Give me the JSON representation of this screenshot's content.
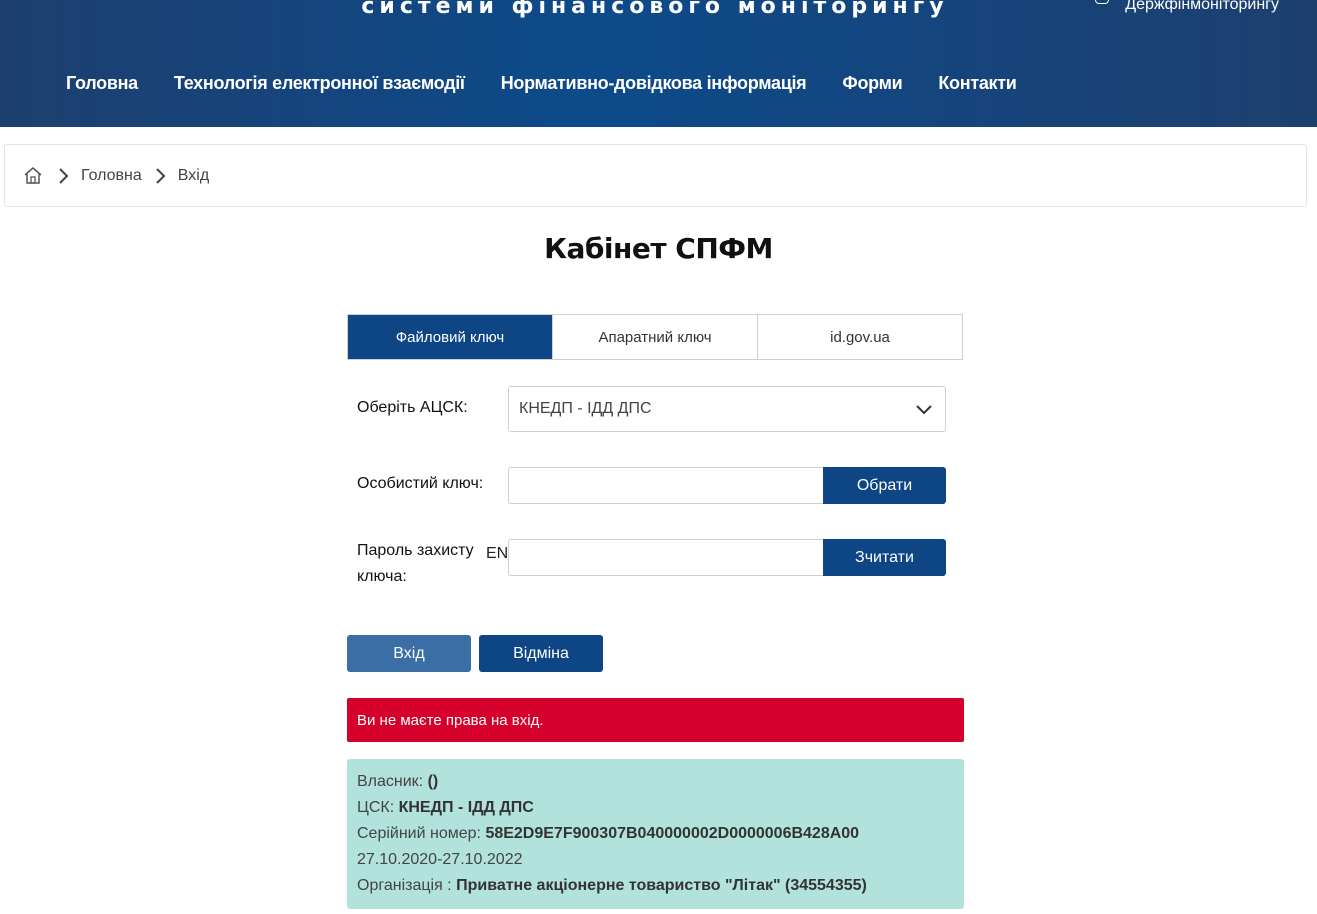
{
  "header": {
    "title": "системи фінансового моніторингу",
    "user_text": "Держфінмоніторингу",
    "nav": [
      "Головна",
      "Технологія електронної взаємодії",
      "Нормативно-довідкова інформація",
      "Форми",
      "Контакти"
    ]
  },
  "breadcrumb": {
    "items": [
      "Головна",
      "Вхід"
    ]
  },
  "page": {
    "title": "Кабінет СПФМ"
  },
  "tabs": [
    {
      "label": "Файловий ключ",
      "active": true
    },
    {
      "label": "Апаратний ключ",
      "active": false
    },
    {
      "label": "id.gov.ua",
      "active": false
    }
  ],
  "form": {
    "acsk_label": "Оберіть АЦСК:",
    "acsk_value": "КНЕДП - ІДД ДПС",
    "key_label": "Особистий ключ:",
    "key_value": "",
    "choose_button": "Обрати",
    "password_label_1": "Пароль захисту",
    "password_label_2": "ключа:",
    "password_lang": "EN",
    "password_value": "",
    "read_button": "Зчитати",
    "login_button": "Вхід",
    "cancel_button": "Відміна"
  },
  "alert": {
    "text": "Ви не маєте права на вхід."
  },
  "info": {
    "owner_label": "Власник:",
    "owner_value": "()",
    "csk_label": "ЦСК:",
    "csk_value": "КНЕДП - ІДД ДПС",
    "serial_label": "Серійний номер:",
    "serial_value": "58E2D9E7F900307B040000002D0000006B428A00",
    "validity": "27.10.2020-27.10.2022",
    "org_label": "Організація :",
    "org_value": "Приватне акціонерне товариство \"Літак\" (34554355)"
  },
  "colors": {
    "header_bg": "#1d3f6e",
    "primary": "#0d4585",
    "alert": "#d6002d",
    "info_bg": "#b2e2dc"
  }
}
